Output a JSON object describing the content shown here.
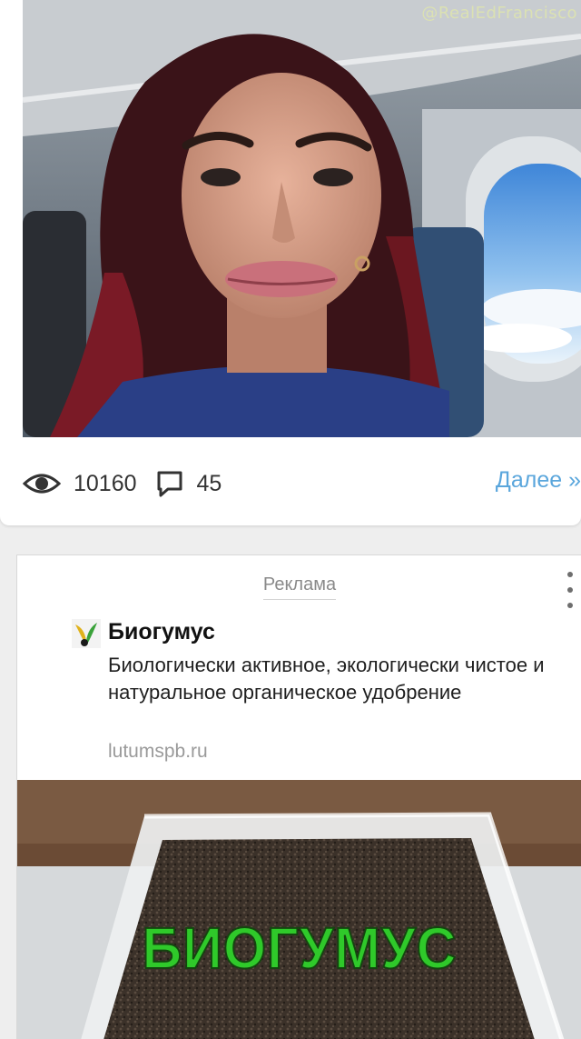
{
  "post": {
    "photo_watermark": "@RealEdFrancisco",
    "views_count": "10160",
    "comments_count": "45",
    "next_link_label": "Далее »",
    "icons": {
      "views": "eye-icon",
      "comments": "comment-bubble-icon"
    }
  },
  "ad": {
    "label": "Реклама",
    "title": "Биогумус",
    "description": "Биологически активное, экологически чистое и натуральное органическое удобрение",
    "domain": "lutumspb.ru",
    "image_caption": "БИОГУМУС",
    "icons": {
      "menu": "more-vertical-icon",
      "logo": "biogumus-logo-icon"
    }
  },
  "colors": {
    "link": "#5aa6dc",
    "caption_green": "#2fc92a",
    "page_background": "#eeeeee"
  }
}
